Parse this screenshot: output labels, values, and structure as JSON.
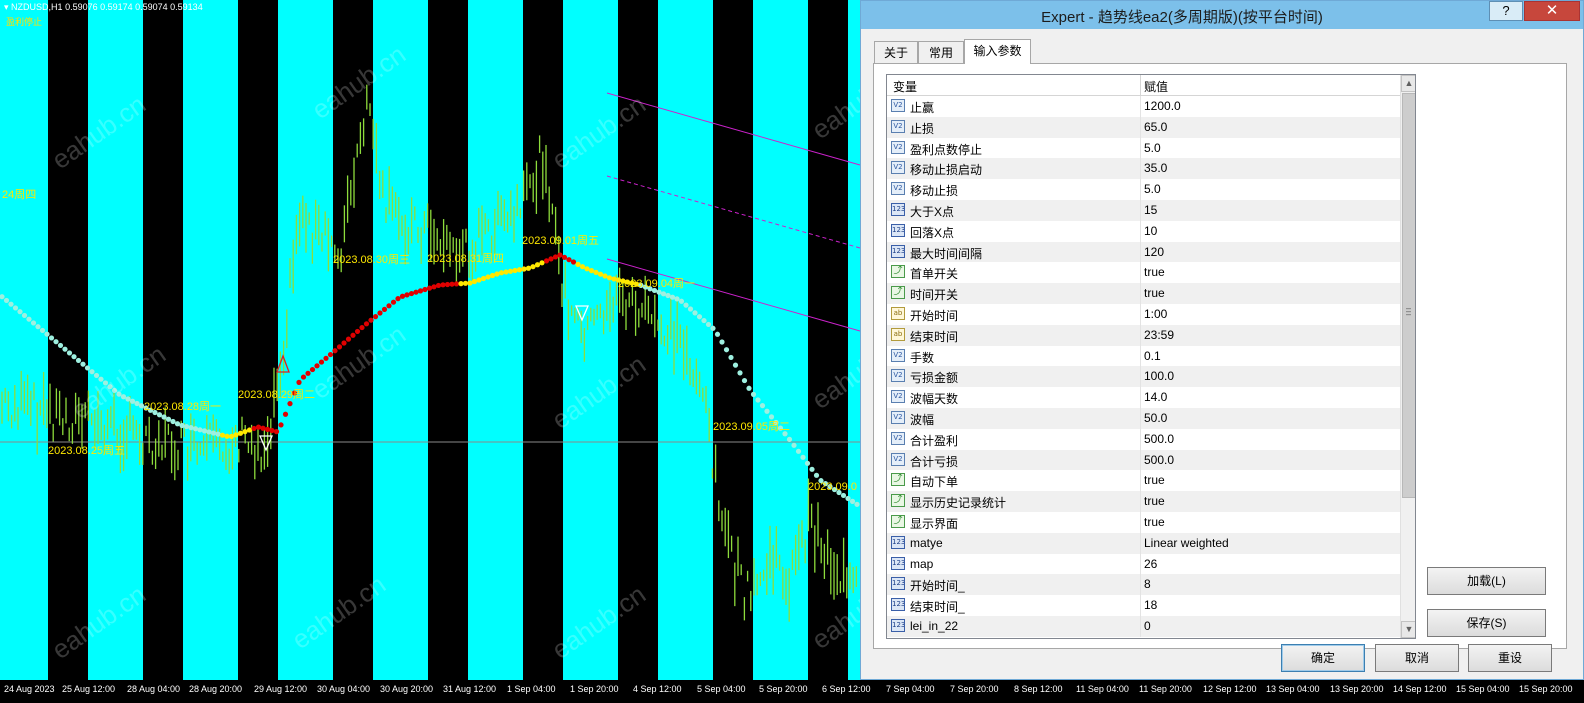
{
  "chart": {
    "symbol": "NZDUSD,H1",
    "ohlc": "0.59076 0.59174 0.59074 0.59134",
    "indicator_label": "盈利停止",
    "colors": {
      "band_light": "#00ffff",
      "band_dark": "#000000",
      "candle": "#8ddc3c",
      "ma_rising": "#e00000",
      "ma_flat": "#ffe800",
      "ma_falling": "#9ef0e0",
      "trend_line": "#cc22cc",
      "label": "#ffe800"
    },
    "date_labels": [
      "24周四",
      "2023.08.28周一",
      "2023.08.25周五",
      "2023.08.29周二",
      "2023.08.30周三",
      "2023.08.31周四",
      "2023.09.01周五",
      "2023.09.04周一",
      "2023.09.05周二",
      "2023.09.0"
    ],
    "time_axis": [
      "24 Aug 2023",
      "25 Aug 12:00",
      "28 Aug 04:00",
      "28 Aug 20:00",
      "29 Aug 12:00",
      "30 Aug 04:00",
      "30 Aug 20:00",
      "31 Aug 12:00",
      "1 Sep 04:00",
      "1 Sep 20:00",
      "4 Sep 12:00",
      "5 Sep 04:00",
      "5 Sep 20:00",
      "6 Sep 12:00",
      "7 Sep 04:00",
      "7 Sep 20:00",
      "8 Sep 12:00",
      "11 Sep 04:00",
      "11 Sep 20:00",
      "12 Sep 12:00",
      "13 Sep 04:00",
      "13 Sep 20:00",
      "14 Sep 12:00",
      "15 Sep 04:00",
      "15 Sep 20:00"
    ],
    "watermark": "eahub.cn"
  },
  "dialog": {
    "title": "Expert - 趋势线ea2(多周期版)(按平台时间)",
    "help_label": "?",
    "close_label": "✕",
    "tabs": [
      {
        "label": "关于",
        "active": false
      },
      {
        "label": "常用",
        "active": false
      },
      {
        "label": "输入参数",
        "active": true
      }
    ],
    "grid": {
      "col_variable": "变量",
      "col_value": "赋值",
      "rows": [
        {
          "type": "double",
          "icon": "V2",
          "name": "止赢",
          "value": "1200.0"
        },
        {
          "type": "double",
          "icon": "V2",
          "name": "止损",
          "value": "65.0"
        },
        {
          "type": "double",
          "icon": "V2",
          "name": "盈利点数停止",
          "value": "5.0"
        },
        {
          "type": "double",
          "icon": "V2",
          "name": "移动止损启动",
          "value": "35.0"
        },
        {
          "type": "double",
          "icon": "V2",
          "name": "移动止损",
          "value": "5.0"
        },
        {
          "type": "int",
          "icon": "123",
          "name": "大于X点",
          "value": "15"
        },
        {
          "type": "int",
          "icon": "123",
          "name": "回落X点",
          "value": "10"
        },
        {
          "type": "int",
          "icon": "123",
          "name": "最大时间间隔",
          "value": "120"
        },
        {
          "type": "bool",
          "icon": "⤴",
          "name": "首单开关",
          "value": "true"
        },
        {
          "type": "bool",
          "icon": "⤴",
          "name": "时间开关",
          "value": "true"
        },
        {
          "type": "string",
          "icon": "ab",
          "name": "开始时间",
          "value": "1:00"
        },
        {
          "type": "string",
          "icon": "ab",
          "name": "结束时间",
          "value": "23:59"
        },
        {
          "type": "double",
          "icon": "V2",
          "name": "手数",
          "value": "0.1"
        },
        {
          "type": "double",
          "icon": "V2",
          "name": "亏损金额",
          "value": "100.0"
        },
        {
          "type": "double",
          "icon": "V2",
          "name": "波幅天数",
          "value": "14.0"
        },
        {
          "type": "double",
          "icon": "V2",
          "name": "波幅",
          "value": "50.0"
        },
        {
          "type": "double",
          "icon": "V2",
          "name": "合计盈利",
          "value": "500.0"
        },
        {
          "type": "double",
          "icon": "V2",
          "name": "合计亏损",
          "value": "500.0"
        },
        {
          "type": "bool",
          "icon": "⤴",
          "name": "自动下单",
          "value": "true"
        },
        {
          "type": "bool",
          "icon": "⤴",
          "name": "显示历史记录统计",
          "value": "true"
        },
        {
          "type": "bool",
          "icon": "⤴",
          "name": "显示界面",
          "value": "true"
        },
        {
          "type": "int",
          "icon": "123",
          "name": "matye",
          "value": "Linear weighted"
        },
        {
          "type": "int",
          "icon": "123",
          "name": "map",
          "value": "26"
        },
        {
          "type": "int",
          "icon": "123",
          "name": "开始时间_",
          "value": "8"
        },
        {
          "type": "int",
          "icon": "123",
          "name": "结束时间_",
          "value": "18"
        },
        {
          "type": "int",
          "icon": "123",
          "name": "lei_in_22",
          "value": "0"
        }
      ]
    },
    "buttons": {
      "load": "加载(L)",
      "save": "保存(S)",
      "ok": "确定",
      "cancel": "取消",
      "reset": "重设"
    }
  }
}
